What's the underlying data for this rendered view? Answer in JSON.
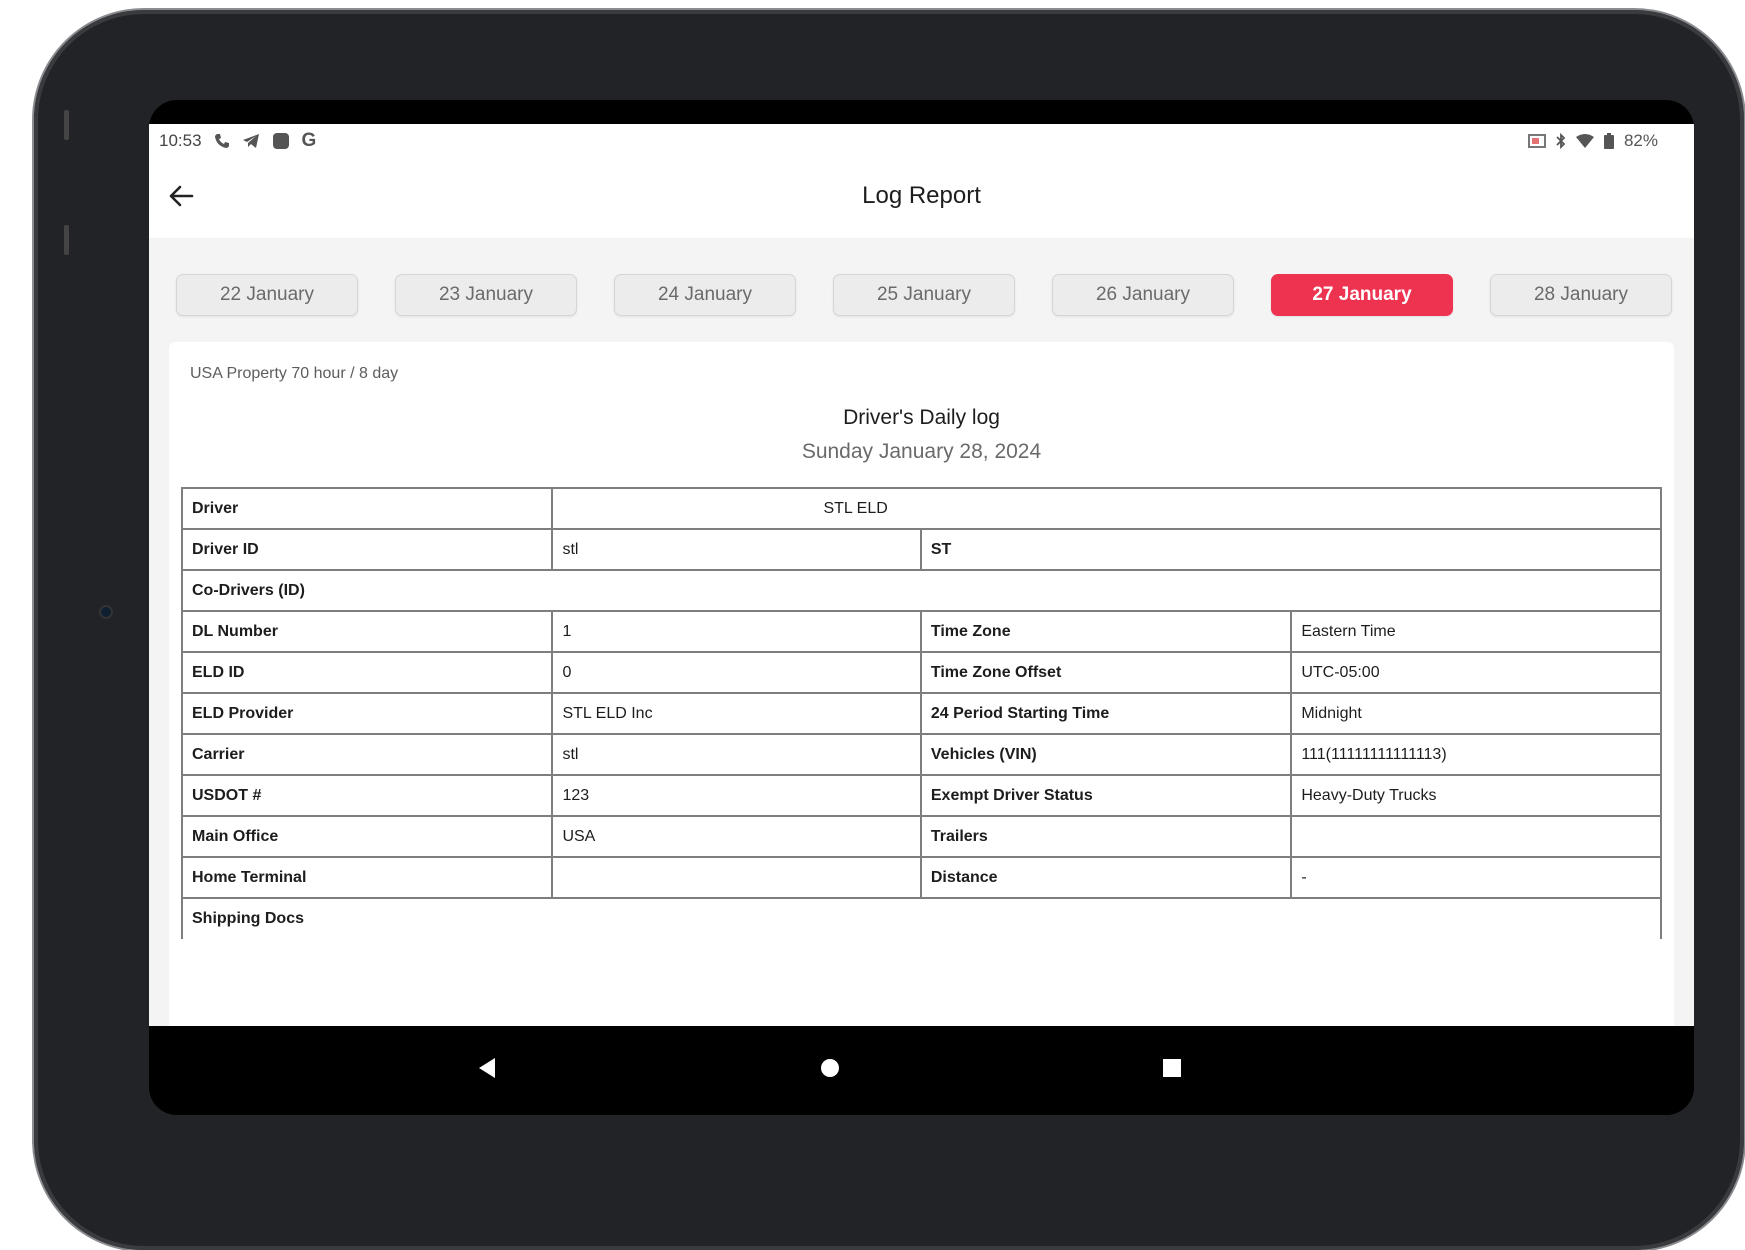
{
  "status_bar": {
    "time": "10:53",
    "left_icons": [
      "phone-icon",
      "telegram-icon",
      "app-square-icon",
      "google-icon"
    ],
    "right_icons": [
      "cast-icon",
      "bluetooth-icon",
      "wifi-icon",
      "battery-icon"
    ],
    "battery": "82%"
  },
  "app_bar": {
    "title": "Log Report",
    "back_icon": "arrow-left-icon"
  },
  "date_tabs": [
    {
      "label": "22 January",
      "active": false
    },
    {
      "label": "23 January",
      "active": false
    },
    {
      "label": "24 January",
      "active": false
    },
    {
      "label": "25 January",
      "active": false
    },
    {
      "label": "26 January",
      "active": false
    },
    {
      "label": "27 January",
      "active": true
    },
    {
      "label": "28 January",
      "active": false
    }
  ],
  "log": {
    "ruleset": "USA Property 70 hour / 8 day",
    "title": "Driver's Daily log",
    "date": "Sunday January 28, 2024",
    "rows": {
      "driver": {
        "label": "Driver",
        "value": "STL ELD"
      },
      "driver_id": {
        "label": "Driver ID",
        "value": "stl",
        "label2": "ST",
        "value2": ""
      },
      "co_drivers": {
        "label": "Co-Drivers (ID)",
        "value": ""
      },
      "dl_number": {
        "label": "DL Number",
        "value": "1",
        "label2": "Time Zone",
        "value2": "Eastern Time"
      },
      "eld_id": {
        "label": "ELD ID",
        "value": "0",
        "label2": "Time Zone Offset",
        "value2": "UTC-05:00"
      },
      "eld_provider": {
        "label": "ELD Provider",
        "value": "STL ELD Inc",
        "label2": "24 Period Starting Time",
        "value2": "Midnight"
      },
      "carrier": {
        "label": "Carrier",
        "value": "stl",
        "label2": "Vehicles (VIN)",
        "value2": "111(11111111111113)"
      },
      "usdot": {
        "label": "USDOT #",
        "value": "123",
        "label2": "Exempt Driver Status",
        "value2": "Heavy-Duty Trucks"
      },
      "main_office": {
        "label": "Main Office",
        "value": "USA",
        "label2": "Trailers",
        "value2": ""
      },
      "home_terminal": {
        "label": "Home Terminal",
        "value": "",
        "label2": "Distance",
        "value2": "-"
      },
      "shipping_docs": {
        "label": "Shipping Docs",
        "value": ""
      }
    }
  },
  "nav_bar": {
    "icons": [
      "back-triangle-icon",
      "home-circle-icon",
      "recents-square-icon"
    ]
  },
  "colors": {
    "accent": "#ee3351",
    "tab_bg": "#ececed",
    "frame": "#222326"
  }
}
